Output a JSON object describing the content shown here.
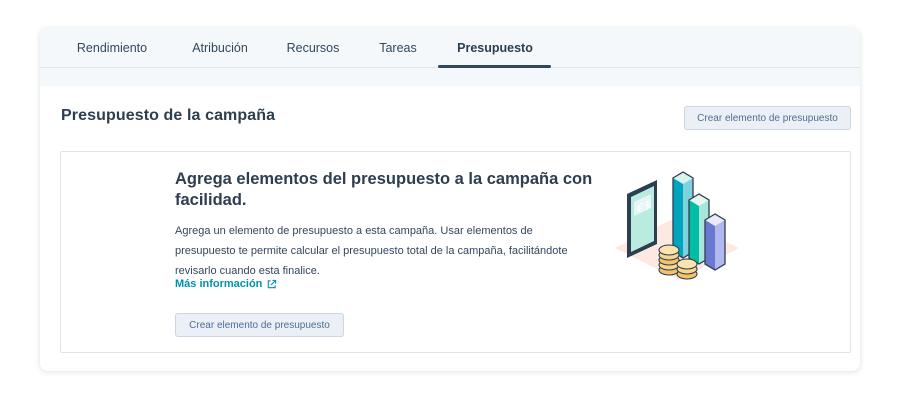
{
  "tabs": [
    {
      "label": "Rendimiento",
      "active": false
    },
    {
      "label": "Atribución",
      "active": false
    },
    {
      "label": "Recursos",
      "active": false
    },
    {
      "label": "Tareas",
      "active": false
    },
    {
      "label": "Presupuesto",
      "active": true
    }
  ],
  "section": {
    "title": "Presupuesto de la campaña",
    "create_button": "Crear elemento de presupuesto"
  },
  "empty_state": {
    "heading": "Agrega elementos del presupuesto a la campaña con facilidad.",
    "description": "Agrega un elemento de presupuesto a esta campaña. Usar elementos de presupuesto te permite calcular el presupuesto total de la campaña, facilitándote revisarlo cuando esta finalice.",
    "learn_more": "Más información",
    "create_button": "Crear elemento de presupuesto",
    "illustration": "budget-chart-coins-illustration"
  },
  "colors": {
    "accent_link": "#0091ae",
    "text_dark": "#2d3e50",
    "tab_bar_bg": "#f5f8fa",
    "button_bg": "#eaf0f6"
  }
}
